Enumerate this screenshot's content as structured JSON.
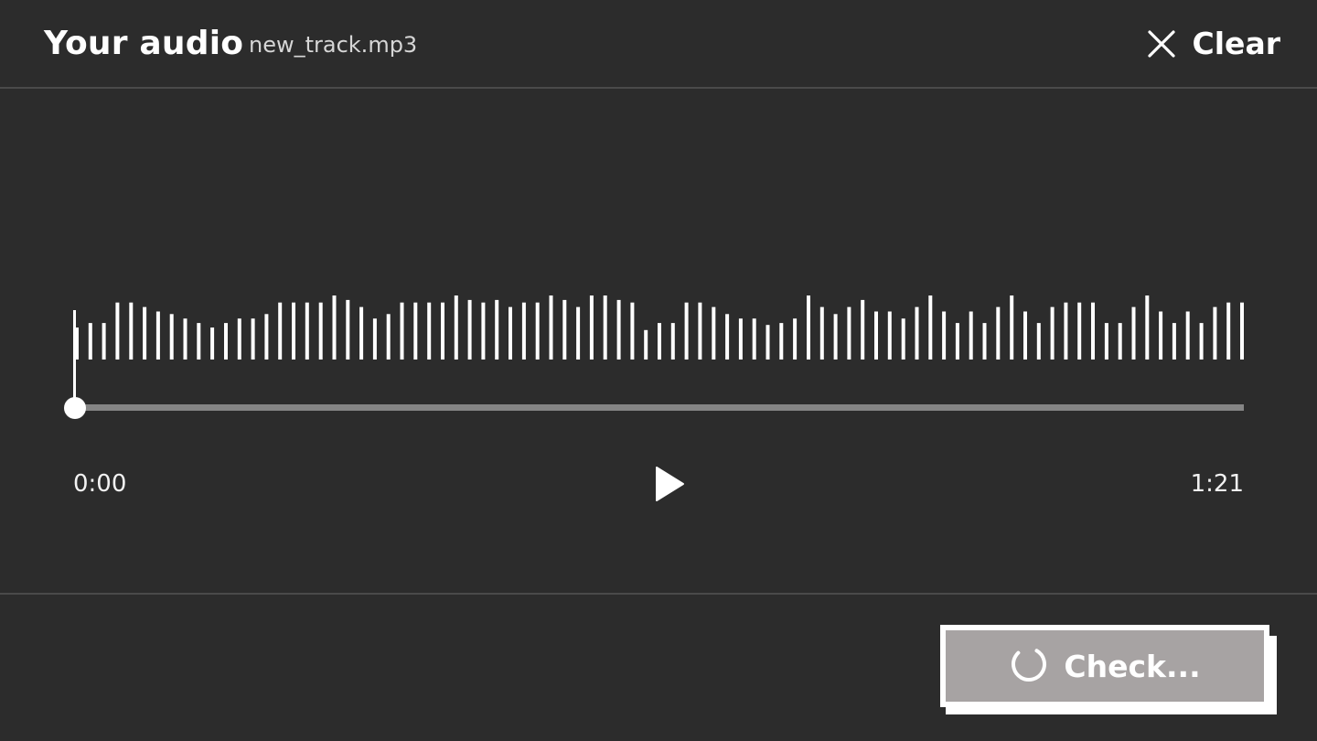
{
  "header": {
    "title": "Your audio",
    "filename": "new_track.mp3",
    "clear_label": "Clear"
  },
  "player": {
    "current_time": "0:00",
    "total_time": "1:21",
    "progress": 0,
    "waveform_levels": [
      0.5,
      0.57,
      0.57,
      0.89,
      0.89,
      0.82,
      0.75,
      0.71,
      0.64,
      0.57,
      0.5,
      0.57,
      0.64,
      0.64,
      0.71,
      0.89,
      0.89,
      0.89,
      0.89,
      1.0,
      0.93,
      0.82,
      0.64,
      0.71,
      0.89,
      0.89,
      0.89,
      0.89,
      1.0,
      0.93,
      0.89,
      0.93,
      0.82,
      0.89,
      0.89,
      1.0,
      0.93,
      0.82,
      1.0,
      1.0,
      0.93,
      0.89,
      0.46,
      0.57,
      0.57,
      0.89,
      0.89,
      0.82,
      0.71,
      0.64,
      0.64,
      0.54,
      0.57,
      0.64,
      1.0,
      0.82,
      0.71,
      0.82,
      0.93,
      0.75,
      0.75,
      0.64,
      0.82,
      1.0,
      0.75,
      0.57,
      0.75,
      0.57,
      0.82,
      1.0,
      0.75,
      0.57,
      0.82,
      0.89,
      0.89,
      0.89,
      0.57,
      0.57,
      0.82,
      1.0,
      0.75,
      0.57,
      0.75,
      0.57,
      0.82,
      0.89,
      0.89
    ]
  },
  "footer": {
    "check_label": "Check..."
  },
  "colors": {
    "background": "#2c2c2c",
    "divider": "#4a4a4a",
    "track": "#858585",
    "button_fill": "#a7a3a3",
    "foreground": "#ffffff"
  }
}
